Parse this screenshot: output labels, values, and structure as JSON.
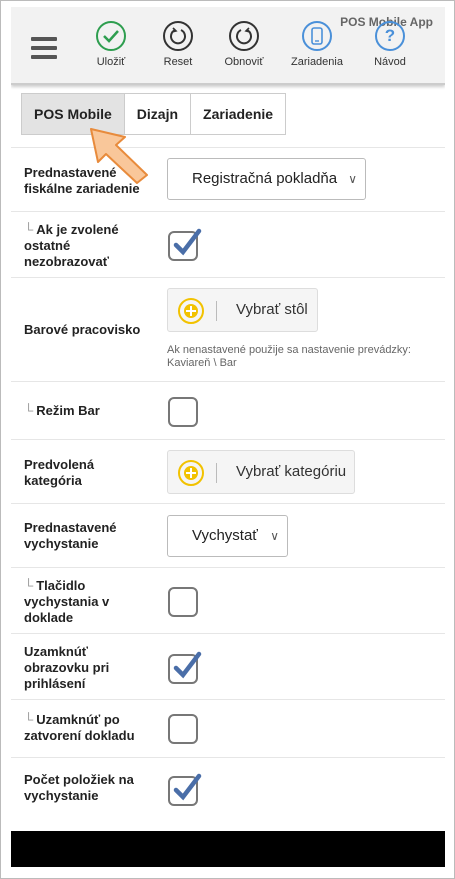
{
  "app_name": "POS Mobile App",
  "toolbar": {
    "save_label": "Uložiť",
    "reset_label": "Reset",
    "refresh_label": "Obnoviť",
    "devices_label": "Zariadenia",
    "guide_label": "Návod"
  },
  "tabs": [
    {
      "label": "POS Mobile",
      "active": true
    },
    {
      "label": "Dizajn",
      "active": false
    },
    {
      "label": "Zariadenie",
      "active": false
    }
  ],
  "settings": {
    "fiscal_device": {
      "label": "Prednastavené fiskálne zariadenie",
      "value": "Registračná pokladňa"
    },
    "hide_other": {
      "prefix": "└",
      "label": "Ak je zvolené ostatné nezobrazovať",
      "checked": true
    },
    "bar_station": {
      "label": "Barové pracovisko",
      "button": "Vybrať stôl",
      "hint": "Ak nenastavené použije sa nastavenie prevádzky: Kaviareň \\ Bar"
    },
    "bar_mode": {
      "prefix": "└",
      "label": "Režim Bar",
      "checked": false
    },
    "default_category": {
      "label": "Predvolená kategória",
      "button": "Vybrať kategóriu"
    },
    "default_dispatch": {
      "label": "Prednastavené vychystanie",
      "value": "Vychystať"
    },
    "dispatch_button": {
      "prefix": "└",
      "label": "Tlačidlo vychystania v doklade",
      "checked": false
    },
    "lock_on_login": {
      "label": "Uzamknúť obrazovku pri prihlásení",
      "checked": true
    },
    "lock_on_close": {
      "prefix": "└",
      "label": "Uzamknúť po zatvorení dokladu",
      "checked": false
    },
    "items_count": {
      "label": "Počet položiek na vychystanie",
      "checked": true
    }
  },
  "colors": {
    "check": "#4a6ea8",
    "plus": "#f2c200",
    "toolbar_green": "#2e9e4f",
    "toolbar_blue": "#4a90d9"
  }
}
